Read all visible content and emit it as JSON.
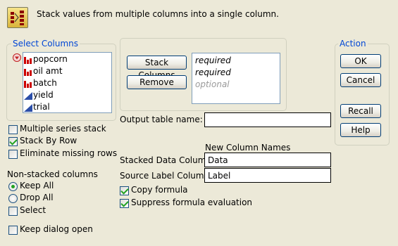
{
  "header": {
    "description": "Stack values from multiple columns into a single column."
  },
  "select_columns": {
    "title": "Select Columns",
    "columns": [
      {
        "name": "popcorn",
        "type": "nominal"
      },
      {
        "name": "oil amt",
        "type": "nominal"
      },
      {
        "name": "batch",
        "type": "nominal"
      },
      {
        "name": "yield",
        "type": "continuous"
      },
      {
        "name": "trial",
        "type": "continuous"
      }
    ]
  },
  "roles": {
    "stack_button": "Stack Columns",
    "remove_button": "Remove",
    "slots": [
      "required",
      "required",
      "optional"
    ]
  },
  "action": {
    "title": "Action",
    "ok": "OK",
    "cancel": "Cancel",
    "recall": "Recall",
    "help": "Help"
  },
  "options": {
    "multiple_series": {
      "label": "Multiple series stack",
      "checked": false
    },
    "stack_by_row": {
      "label": "Stack By Row",
      "checked": true
    },
    "eliminate_missing": {
      "label": "Eliminate missing rows",
      "checked": false
    }
  },
  "non_stacked": {
    "title": "Non-stacked columns",
    "keep_all": {
      "label": "Keep All",
      "checked": true
    },
    "drop_all": {
      "label": "Drop All",
      "checked": false
    },
    "select": {
      "label": "Select",
      "checked": false
    }
  },
  "keep_dialog": {
    "label": "Keep dialog open",
    "checked": false
  },
  "output": {
    "table_name_label": "Output table name:",
    "table_name_value": "",
    "new_column_names_title": "New Column Names",
    "stacked_label": "Stacked Data Column",
    "stacked_value": "Data",
    "source_label": "Source Label Column",
    "source_value": "Label",
    "copy_formula": {
      "label": "Copy formula",
      "checked": true
    },
    "suppress_formula": {
      "label": "Suppress formula evaluation",
      "checked": true
    }
  },
  "colors": {
    "background": "#ece9d8",
    "group_title": "#0046d5",
    "nominal_icon": "#cc0000",
    "continuous_icon": "#2b4ea8",
    "check_mark": "#21a121"
  }
}
